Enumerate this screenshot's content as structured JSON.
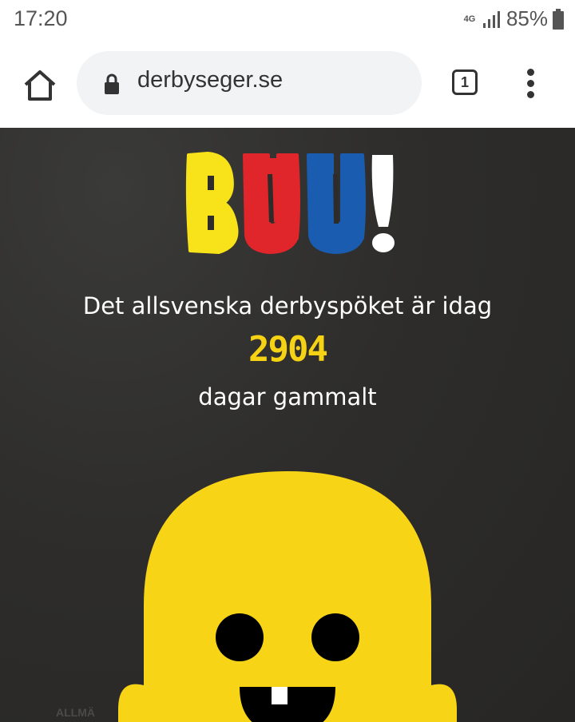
{
  "status_bar": {
    "time": "17:20",
    "network": "4G",
    "battery_pct": "85%"
  },
  "browser": {
    "url": "derbyseger.se",
    "tab_count": "1"
  },
  "page": {
    "logo_text": "BUU!",
    "logo_colors": [
      "#f8e21a",
      "#e0262a",
      "#1a5db0",
      "#ffffff"
    ],
    "line1": "Det allsvenska derbyspöket är idag",
    "days_count": "2904",
    "line3": "dagar gammalt",
    "background_text": "ALLMÄ",
    "accent_color": "#f5d314"
  }
}
